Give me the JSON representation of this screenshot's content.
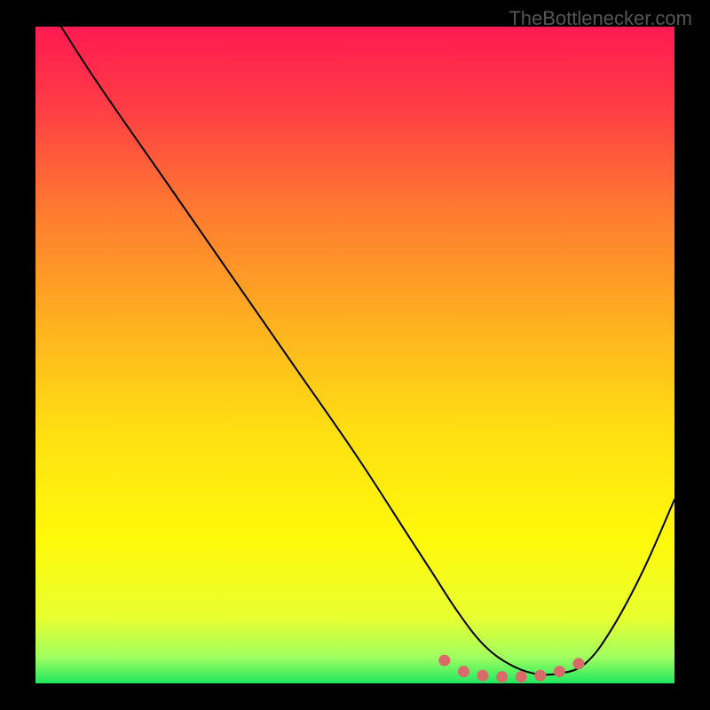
{
  "watermark": "TheBottlenecker.com",
  "chart_data": {
    "type": "line",
    "title": "",
    "xlabel": "",
    "ylabel": "",
    "xlim": [
      0,
      100
    ],
    "ylim": [
      0,
      100
    ],
    "grid": false,
    "legend": false,
    "background_gradient": {
      "stops": [
        {
          "offset": 0.0,
          "color": "#ff1a52"
        },
        {
          "offset": 0.12,
          "color": "#ff3c45"
        },
        {
          "offset": 0.28,
          "color": "#ff7a30"
        },
        {
          "offset": 0.45,
          "color": "#ffb020"
        },
        {
          "offset": 0.62,
          "color": "#ffe012"
        },
        {
          "offset": 0.78,
          "color": "#fff90a"
        },
        {
          "offset": 0.9,
          "color": "#e8ff30"
        },
        {
          "offset": 0.96,
          "color": "#a0ff60"
        },
        {
          "offset": 1.0,
          "color": "#20e860"
        }
      ]
    },
    "series": [
      {
        "name": "main-curve",
        "x": [
          4,
          10,
          20,
          30,
          40,
          50,
          58,
          62,
          66,
          70,
          74,
          78,
          82,
          86,
          90,
          95,
          100
        ],
        "y": [
          100,
          91,
          77,
          63,
          49,
          35,
          23,
          17,
          11,
          6,
          3,
          1.5,
          1.5,
          3,
          8,
          17,
          28
        ],
        "stroke": "#000000",
        "stroke_width": 2
      }
    ],
    "markers": [
      {
        "name": "marker-dots",
        "color": "#d96a6a",
        "points": [
          {
            "x": 64,
            "y": 3.5
          },
          {
            "x": 67,
            "y": 1.8
          },
          {
            "x": 70,
            "y": 1.2
          },
          {
            "x": 73,
            "y": 1.0
          },
          {
            "x": 76,
            "y": 1.0
          },
          {
            "x": 79,
            "y": 1.2
          },
          {
            "x": 82,
            "y": 1.8
          },
          {
            "x": 85,
            "y": 3.0
          }
        ]
      }
    ]
  }
}
